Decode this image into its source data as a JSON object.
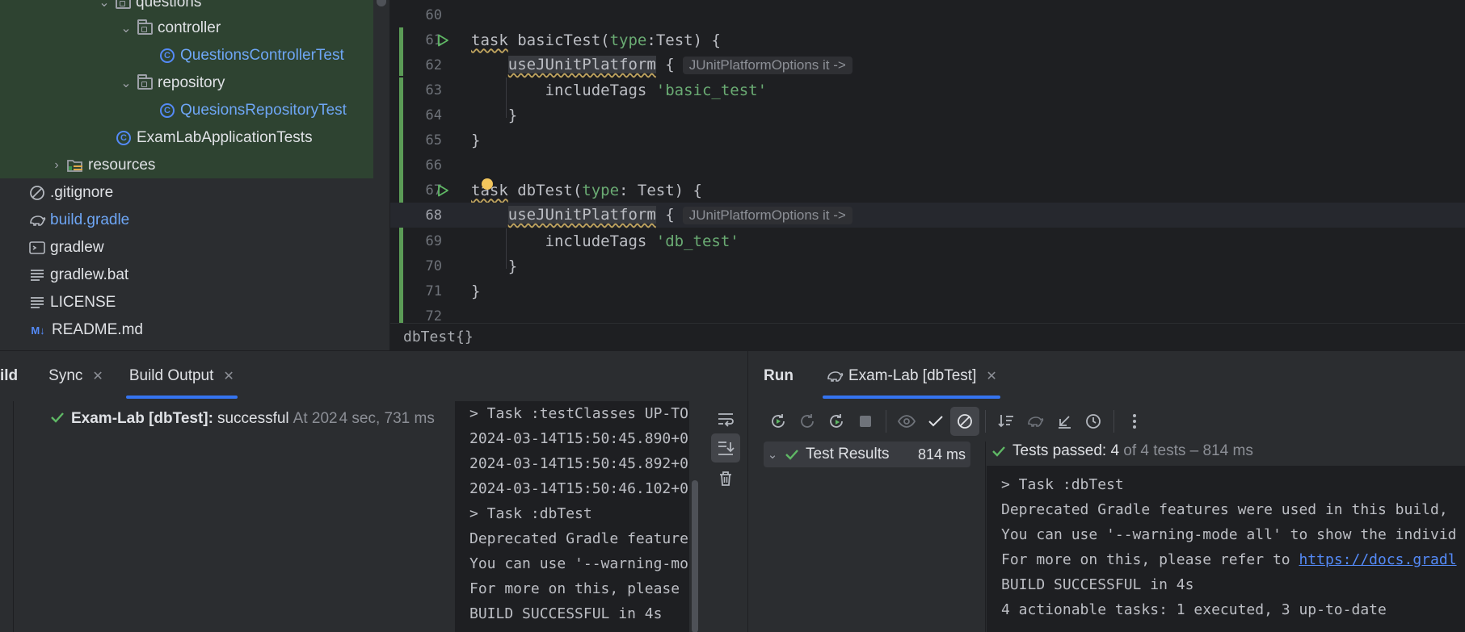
{
  "project_tree": {
    "items": [
      {
        "label": "questions",
        "kind": "folder",
        "expanded": true
      },
      {
        "label": "controller",
        "kind": "folder",
        "expanded": true
      },
      {
        "label": "QuestionsControllerTest",
        "kind": "class"
      },
      {
        "label": "repository",
        "kind": "folder",
        "expanded": true
      },
      {
        "label": "QuesionsRepositoryTest",
        "kind": "class"
      },
      {
        "label": "ExamLabApplicationTests",
        "kind": "class"
      },
      {
        "label": "resources",
        "kind": "resources-folder",
        "expanded": false
      },
      {
        "label": ".gitignore",
        "kind": "ignore-file"
      },
      {
        "label": "build.gradle",
        "kind": "gradle-file"
      },
      {
        "label": "gradlew",
        "kind": "shell-file"
      },
      {
        "label": "gradlew.bat",
        "kind": "text-file"
      },
      {
        "label": "LICENSE",
        "kind": "text-file"
      },
      {
        "label": "README.md",
        "kind": "markdown-file",
        "icon_text": "M↓"
      }
    ]
  },
  "editor": {
    "line_numbers": [
      "60",
      "61",
      "62",
      "63",
      "64",
      "65",
      "66",
      "67",
      "68",
      "69",
      "70",
      "71",
      "72"
    ],
    "current_line": "68",
    "code": {
      "l61": {
        "kw": "task",
        "name": " basicTest(",
        "param": "type",
        "rest": ":Test) {"
      },
      "l62": {
        "call": "useJUnitPlatform",
        "brace": " {",
        "hint": "JUnitPlatformOptions it ->"
      },
      "l63": {
        "fn": "includeTags ",
        "str": "'basic_test'"
      },
      "l64": "}",
      "l65": "}",
      "l67": {
        "kw": "task",
        "name": " dbTest(",
        "param": "type",
        "rest": ": Test) {"
      },
      "l68": {
        "call": "useJUnitPlatform",
        "brace": " {",
        "hint": "JUnitPlatformOptions it ->"
      },
      "l69": {
        "fn": "includeTags ",
        "str": "'db_test'"
      },
      "l70": "}",
      "l71": "}"
    },
    "breadcrumb": "dbTest{}"
  },
  "build_panel": {
    "tabs": [
      {
        "label": "ild",
        "closable": false
      },
      {
        "label": "Sync",
        "closable": true
      },
      {
        "label": "Build Output",
        "closable": true,
        "active": true
      }
    ],
    "result": {
      "name": "Exam-Lab [dbTest]:",
      "status": "successful",
      "time_prefix": "At 202",
      "duration": "4 sec, 731 ms"
    },
    "console_lines": [
      "> Task :testClasses UP-TO",
      "2024-03-14T15:50:45.890+0",
      "2024-03-14T15:50:45.892+0",
      "2024-03-14T15:50:46.102+0",
      "> Task :dbTest",
      "Deprecated Gradle feature",
      "You can use '--warning-mo",
      "For more on this, please ",
      "BUILD SUCCESSFUL in 4s"
    ]
  },
  "run_panel": {
    "title": "Run",
    "tab_label": "Exam-Lab [dbTest]",
    "test_results": {
      "label": "Test Results",
      "time": "814 ms"
    },
    "status": {
      "prefix": "Tests passed: ",
      "count": "4",
      "suffix": " of 4 tests – 814 ms"
    },
    "console_lines": [
      "> Task :dbTest",
      "Deprecated Gradle features were used in this build,",
      "You can use '--warning-mode all' to show the individ",
      "For more on this, please refer to ",
      "BUILD SUCCESSFUL in 4s",
      "4 actionable tasks: 1 executed, 3 up-to-date"
    ],
    "link_text": "https://docs.gradl"
  },
  "colors": {
    "accent": "#3574f0",
    "success": "#5fb865",
    "keyword": "#cf8e6d",
    "string": "#6aab73",
    "link": "#548af7",
    "vcs_modified": "#5b9b56"
  }
}
